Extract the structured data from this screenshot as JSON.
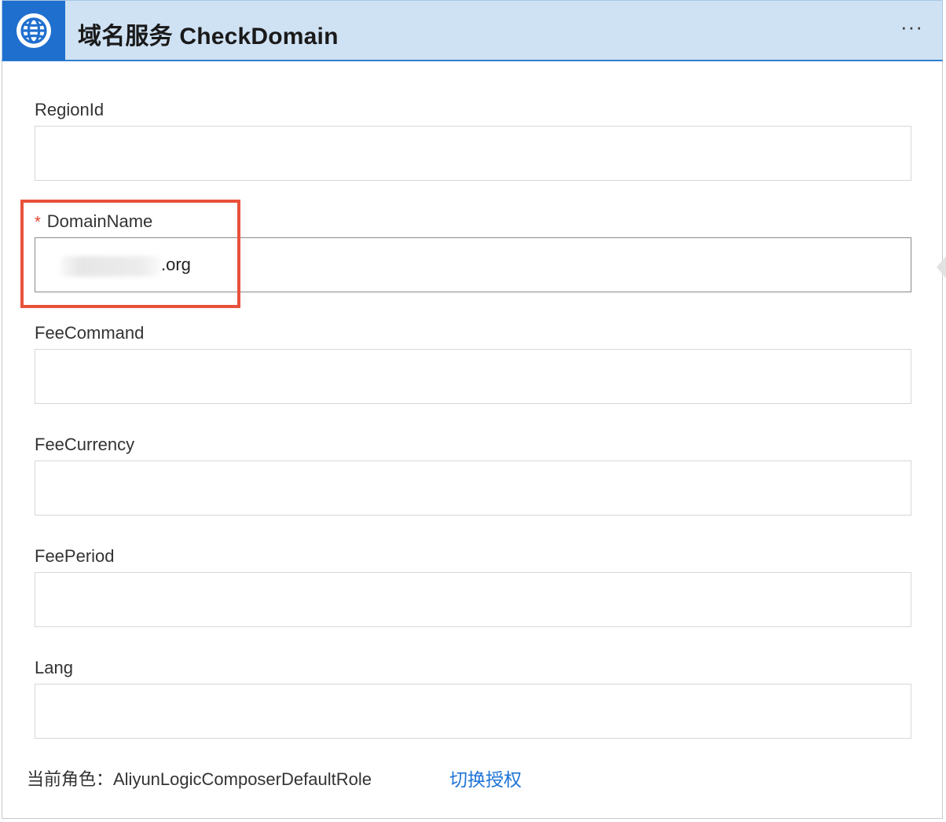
{
  "header": {
    "title": "域名服务 CheckDomain",
    "more_label": "···",
    "icon": "globe-icon",
    "brand_color": "#1f6fcf"
  },
  "fields": {
    "region_id": {
      "label": "RegionId",
      "value": ""
    },
    "domain_name": {
      "label": "DomainName",
      "required_mark": "*",
      "value": ".org"
    },
    "fee_command": {
      "label": "FeeCommand",
      "value": ""
    },
    "fee_currency": {
      "label": "FeeCurrency",
      "value": ""
    },
    "fee_period": {
      "label": "FeePeriod",
      "value": ""
    },
    "lang": {
      "label": "Lang",
      "value": ""
    }
  },
  "footer": {
    "role_text": "当前角色：AliyunLogicComposerDefaultRole",
    "switch_label": "切换授权",
    "link_color": "#1f74d6"
  },
  "highlight_color": "#e8513a"
}
